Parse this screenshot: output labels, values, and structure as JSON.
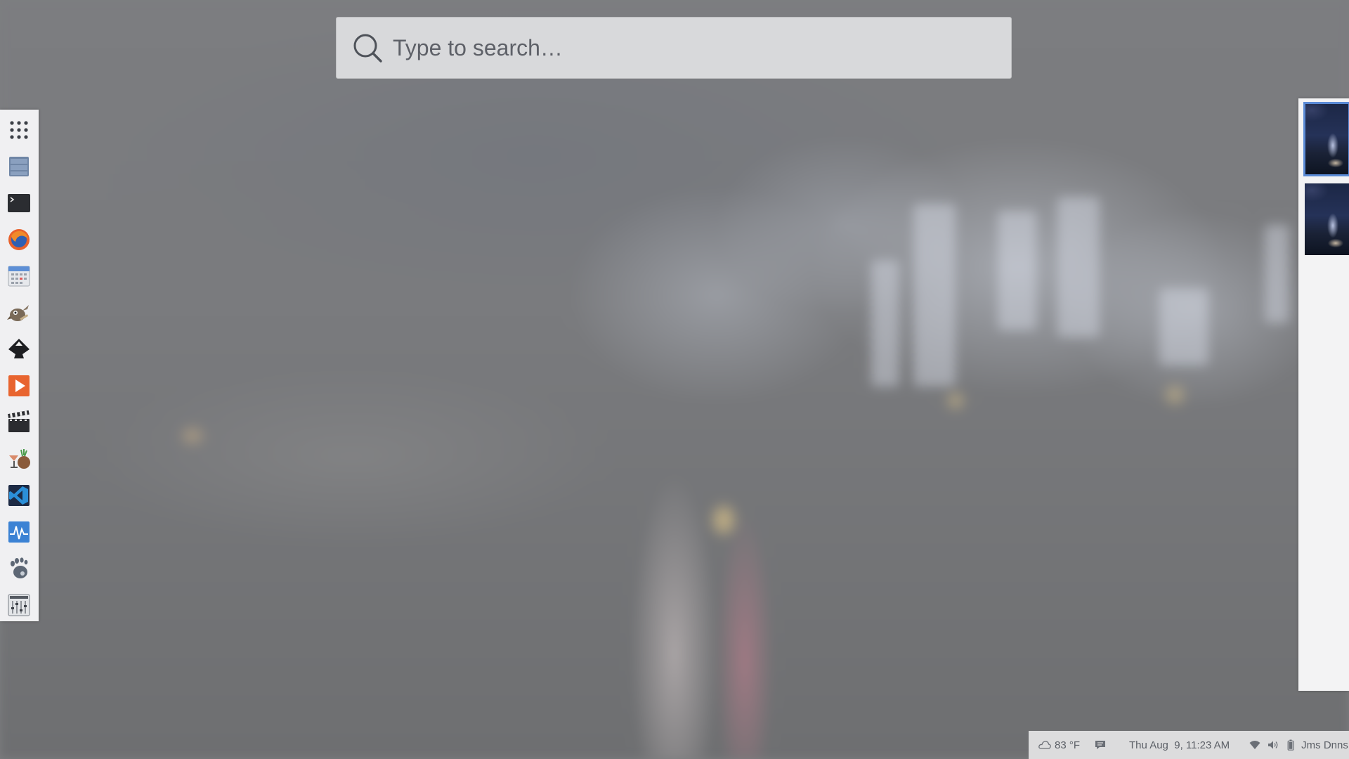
{
  "search": {
    "placeholder": "Type to search…",
    "icon": "search-icon"
  },
  "dock": {
    "items": [
      {
        "name": "show-applications-icon",
        "app": "Show Applications"
      },
      {
        "name": "files-icon",
        "app": "Files"
      },
      {
        "name": "terminal-icon",
        "app": "Terminal"
      },
      {
        "name": "firefox-icon",
        "app": "Firefox"
      },
      {
        "name": "calendar-icon",
        "app": "Calendar"
      },
      {
        "name": "gimp-icon",
        "app": "GIMP"
      },
      {
        "name": "inkscape-icon",
        "app": "Inkscape"
      },
      {
        "name": "media-player-icon",
        "app": "Media Player"
      },
      {
        "name": "video-editor-icon",
        "app": "Video Editor"
      },
      {
        "name": "cocktail-app-icon",
        "app": "Cocktail App"
      },
      {
        "name": "vscode-icon",
        "app": "Visual Studio Code"
      },
      {
        "name": "system-monitor-icon",
        "app": "System Monitor"
      },
      {
        "name": "gnome-foot-icon",
        "app": "GNOME"
      },
      {
        "name": "mixer-icon",
        "app": "Mixer"
      }
    ]
  },
  "workspaces": {
    "count": 2,
    "active_index": 0
  },
  "status_bar": {
    "weather_icon": "cloud-icon",
    "temperature": "83 °F",
    "chat_icon": "chat-icon",
    "datetime": "Thu Aug  9, 11:23 AM",
    "wifi_icon": "wifi-icon",
    "volume_icon": "volume-icon",
    "battery_icon": "battery-icon",
    "user": "Jms Dnns"
  },
  "colors": {
    "search_bg": "#d8d9db",
    "dock_bg": "#f0f0f2",
    "status_bg": "#dcdcdd",
    "active_workspace_outline": "#5b8bd6",
    "desktop_overlay": "#7d7e80"
  }
}
